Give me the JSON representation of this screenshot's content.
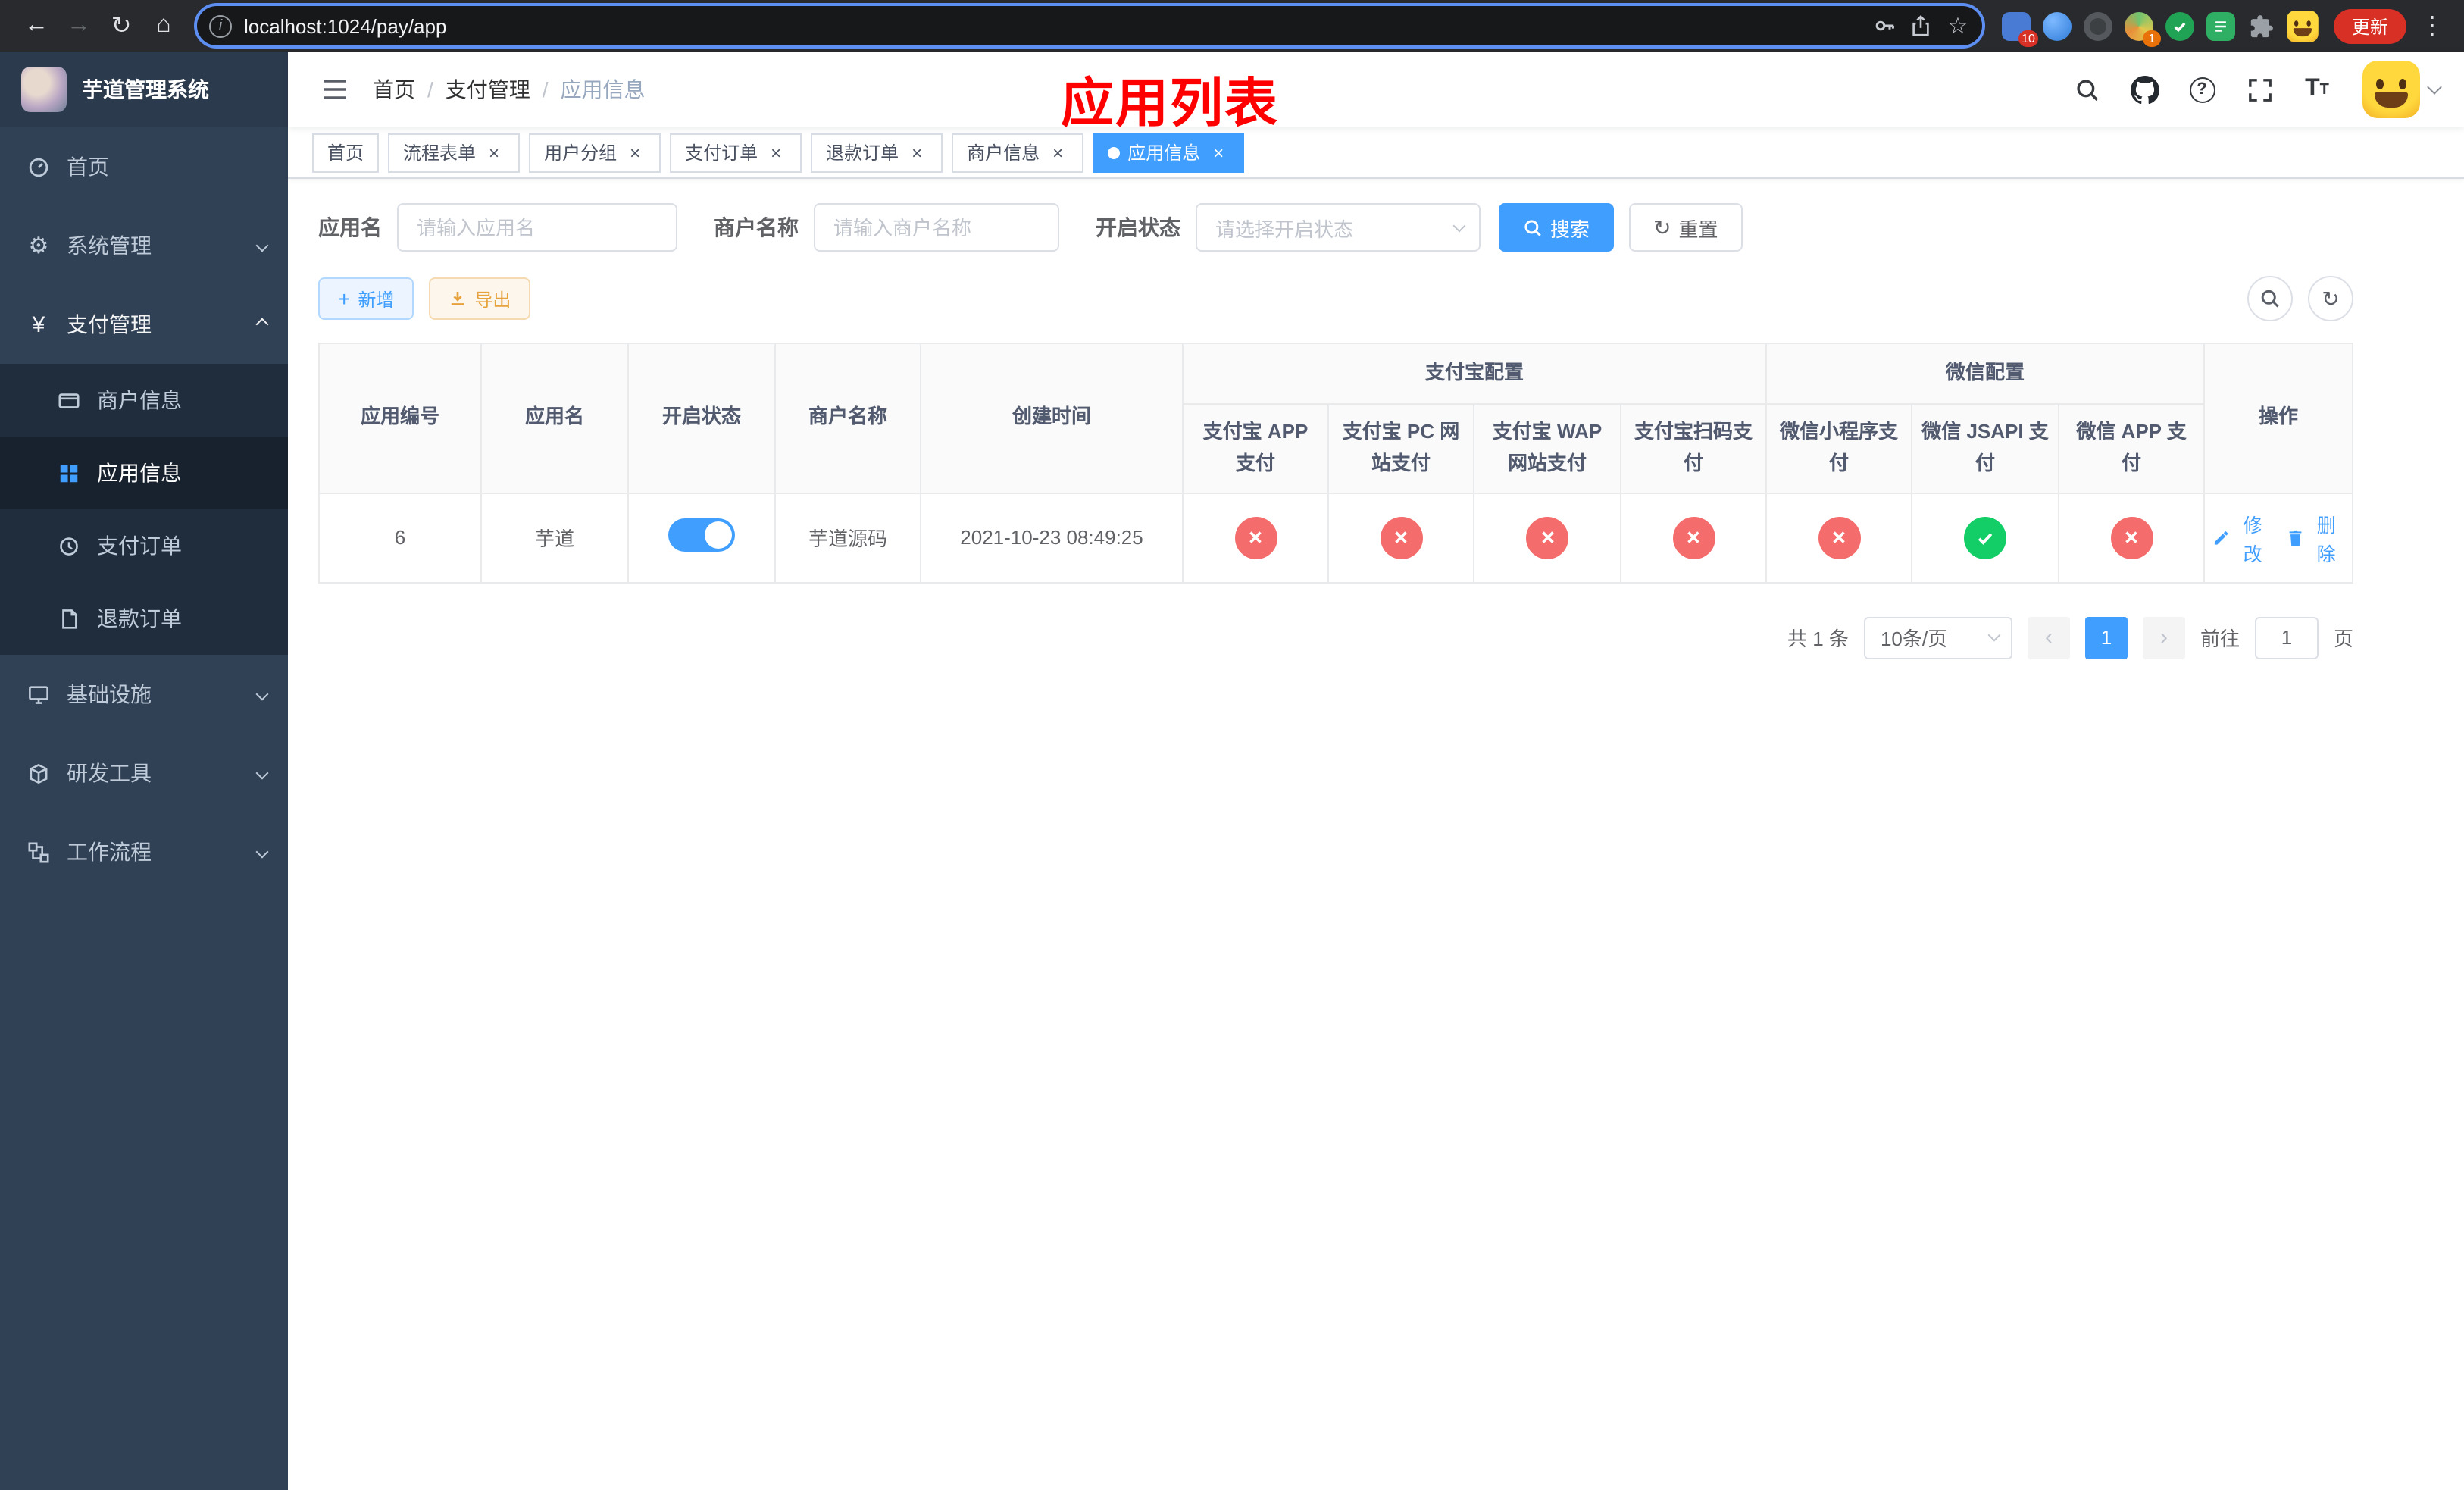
{
  "icons": {
    "back": "←",
    "forward": "→",
    "reload": "↻",
    "home": "⌂",
    "info": "i",
    "star": "☆",
    "menu_dots": "⋮",
    "close": "×",
    "plus": "+",
    "question": "?",
    "gear": "⚙",
    "yen": "¥",
    "prev": "‹",
    "next": "›",
    "font_big": "T",
    "font_small": "T"
  },
  "browser": {
    "url": "localhost:1024/pay/app",
    "update_label": "更新",
    "ext_badge_blue": "10",
    "ext_badge_avatar": "1"
  },
  "sidebar": {
    "title": "芋道管理系统",
    "menu": [
      {
        "label": "首页"
      },
      {
        "label": "系统管理"
      },
      {
        "label": "支付管理",
        "children": [
          {
            "label": "商户信息"
          },
          {
            "label": "应用信息"
          },
          {
            "label": "支付订单"
          },
          {
            "label": "退款订单"
          }
        ]
      },
      {
        "label": "基础设施"
      },
      {
        "label": "研发工具"
      },
      {
        "label": "工作流程"
      }
    ]
  },
  "header": {
    "breadcrumb": [
      "首页",
      "支付管理",
      "应用信息"
    ],
    "breadcrumb_sep": "/",
    "overlay_title": "应用列表"
  },
  "tabs": [
    {
      "label": "首页",
      "closable": false,
      "active": false
    },
    {
      "label": "流程表单",
      "closable": true,
      "active": false
    },
    {
      "label": "用户分组",
      "closable": true,
      "active": false
    },
    {
      "label": "支付订单",
      "closable": true,
      "active": false
    },
    {
      "label": "退款订单",
      "closable": true,
      "active": false
    },
    {
      "label": "商户信息",
      "closable": true,
      "active": false
    },
    {
      "label": "应用信息",
      "closable": true,
      "active": true
    }
  ],
  "filters": {
    "app_name_label": "应用名",
    "app_name_placeholder": "请输入应用名",
    "merchant_label": "商户名称",
    "merchant_placeholder": "请输入商户名称",
    "status_label": "开启状态",
    "status_placeholder": "请选择开启状态",
    "search_label": "搜索",
    "reset_label": "重置"
  },
  "toolbar": {
    "add_label": "新增",
    "export_label": "导出"
  },
  "table": {
    "headers": {
      "id": "应用编号",
      "name": "应用名",
      "status": "开启状态",
      "merchant": "商户名称",
      "created": "创建时间",
      "alipay_group": "支付宝配置",
      "wechat_group": "微信配置",
      "alipay_app": "支付宝 APP 支付",
      "alipay_pc": "支付宝 PC 网站支付",
      "alipay_wap": "支付宝 WAP 网站支付",
      "alipay_qr": "支付宝扫码支付",
      "wx_mini": "微信小程序支付",
      "wx_jsapi": "微信 JSAPI 支付",
      "wx_app": "微信 APP 支付",
      "op": "操作"
    },
    "row": {
      "id": "6",
      "name": "芋道",
      "enabled": true,
      "merchant": "芋道源码",
      "created": "2021-10-23 08:49:25",
      "alipay_app": false,
      "alipay_pc": false,
      "alipay_wap": false,
      "alipay_qr": false,
      "wx_mini": false,
      "wx_jsapi": true,
      "wx_app": false,
      "edit_label": "修改",
      "delete_label": "删除"
    }
  },
  "pagination": {
    "total": "共 1 条",
    "page_size": "10条/页",
    "page": "1",
    "goto_label": "前往",
    "goto_value": "1",
    "unit_label": "页"
  },
  "colors": {
    "primary": "#409eff",
    "success": "#13ce66",
    "danger": "#f56c6c",
    "warning": "#e6a23c"
  }
}
